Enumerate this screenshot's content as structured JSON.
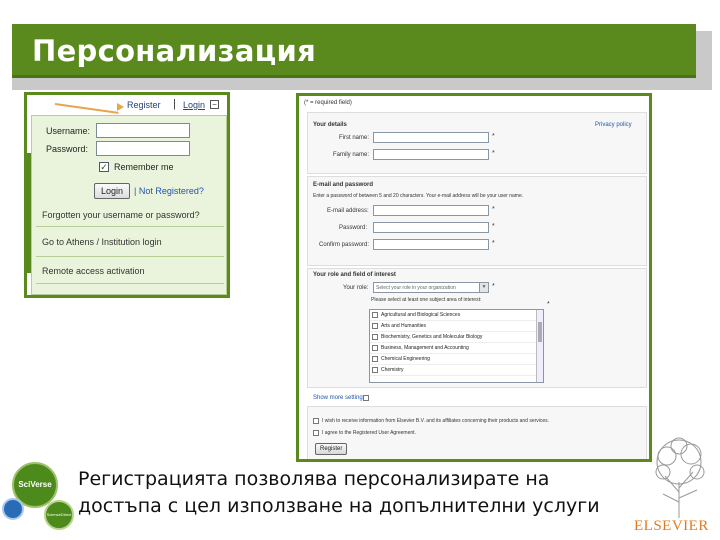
{
  "slide": {
    "title": "Персонализация",
    "caption_line1": "Регистрацията позволява персонализирате на",
    "caption_line2": "достъпа с цел използване на допълнителни услуги"
  },
  "colors": {
    "accent_green": "#5a8a1e",
    "elsevier_orange": "#e07b20"
  },
  "login_screen": {
    "register_link": "Register",
    "separator": "|",
    "login_link": "Login",
    "username_label": "Username:",
    "password_label": "Password:",
    "remember_me_label": "Remember me",
    "login_button": "Login",
    "not_registered_link": "| Not Registered?",
    "forgotten_link": "Forgotten your username or password?",
    "athens_link": "Go to Athens / Institution login",
    "remote_link": "Remote access activation"
  },
  "registration_screen": {
    "required_note": "(* = required field)",
    "privacy_link": "Privacy policy",
    "your_details_heading": "Your details",
    "first_name_label": "First name:",
    "family_name_label": "Family name:",
    "email_section_heading": "E-mail and password",
    "email_section_hint": "Enter a password of between 5 and 20 characters. Your e-mail address will be your user name.",
    "email_label": "E-mail address:",
    "password_label": "Password:",
    "confirm_password_label": "Confirm password:",
    "role_section_heading": "Your role and field of interest",
    "your_role_label": "Your role:",
    "role_select_placeholder": "Select your role in your organization",
    "subject_prompt": "Please select at least one subject area of interest:",
    "subject_areas": [
      "Agricultural and Biological Sciences",
      "Arts and Humanities",
      "Biochemistry, Genetics and Molecular Biology",
      "Business, Management and Accounting",
      "Chemical Engineering",
      "Chemistry"
    ],
    "show_more_link": "Show more settings",
    "receive_info_label": "I wish to receive information from Elsevier B.V. and its affiliates concerning their products and services.",
    "agree_label": "I agree to the Registered User Agreement.",
    "register_button": "Register"
  },
  "logos": {
    "sciverse": "SciVerse",
    "sciencedirect": "ScienceDirect",
    "elsevier": "ELSEVIER"
  }
}
